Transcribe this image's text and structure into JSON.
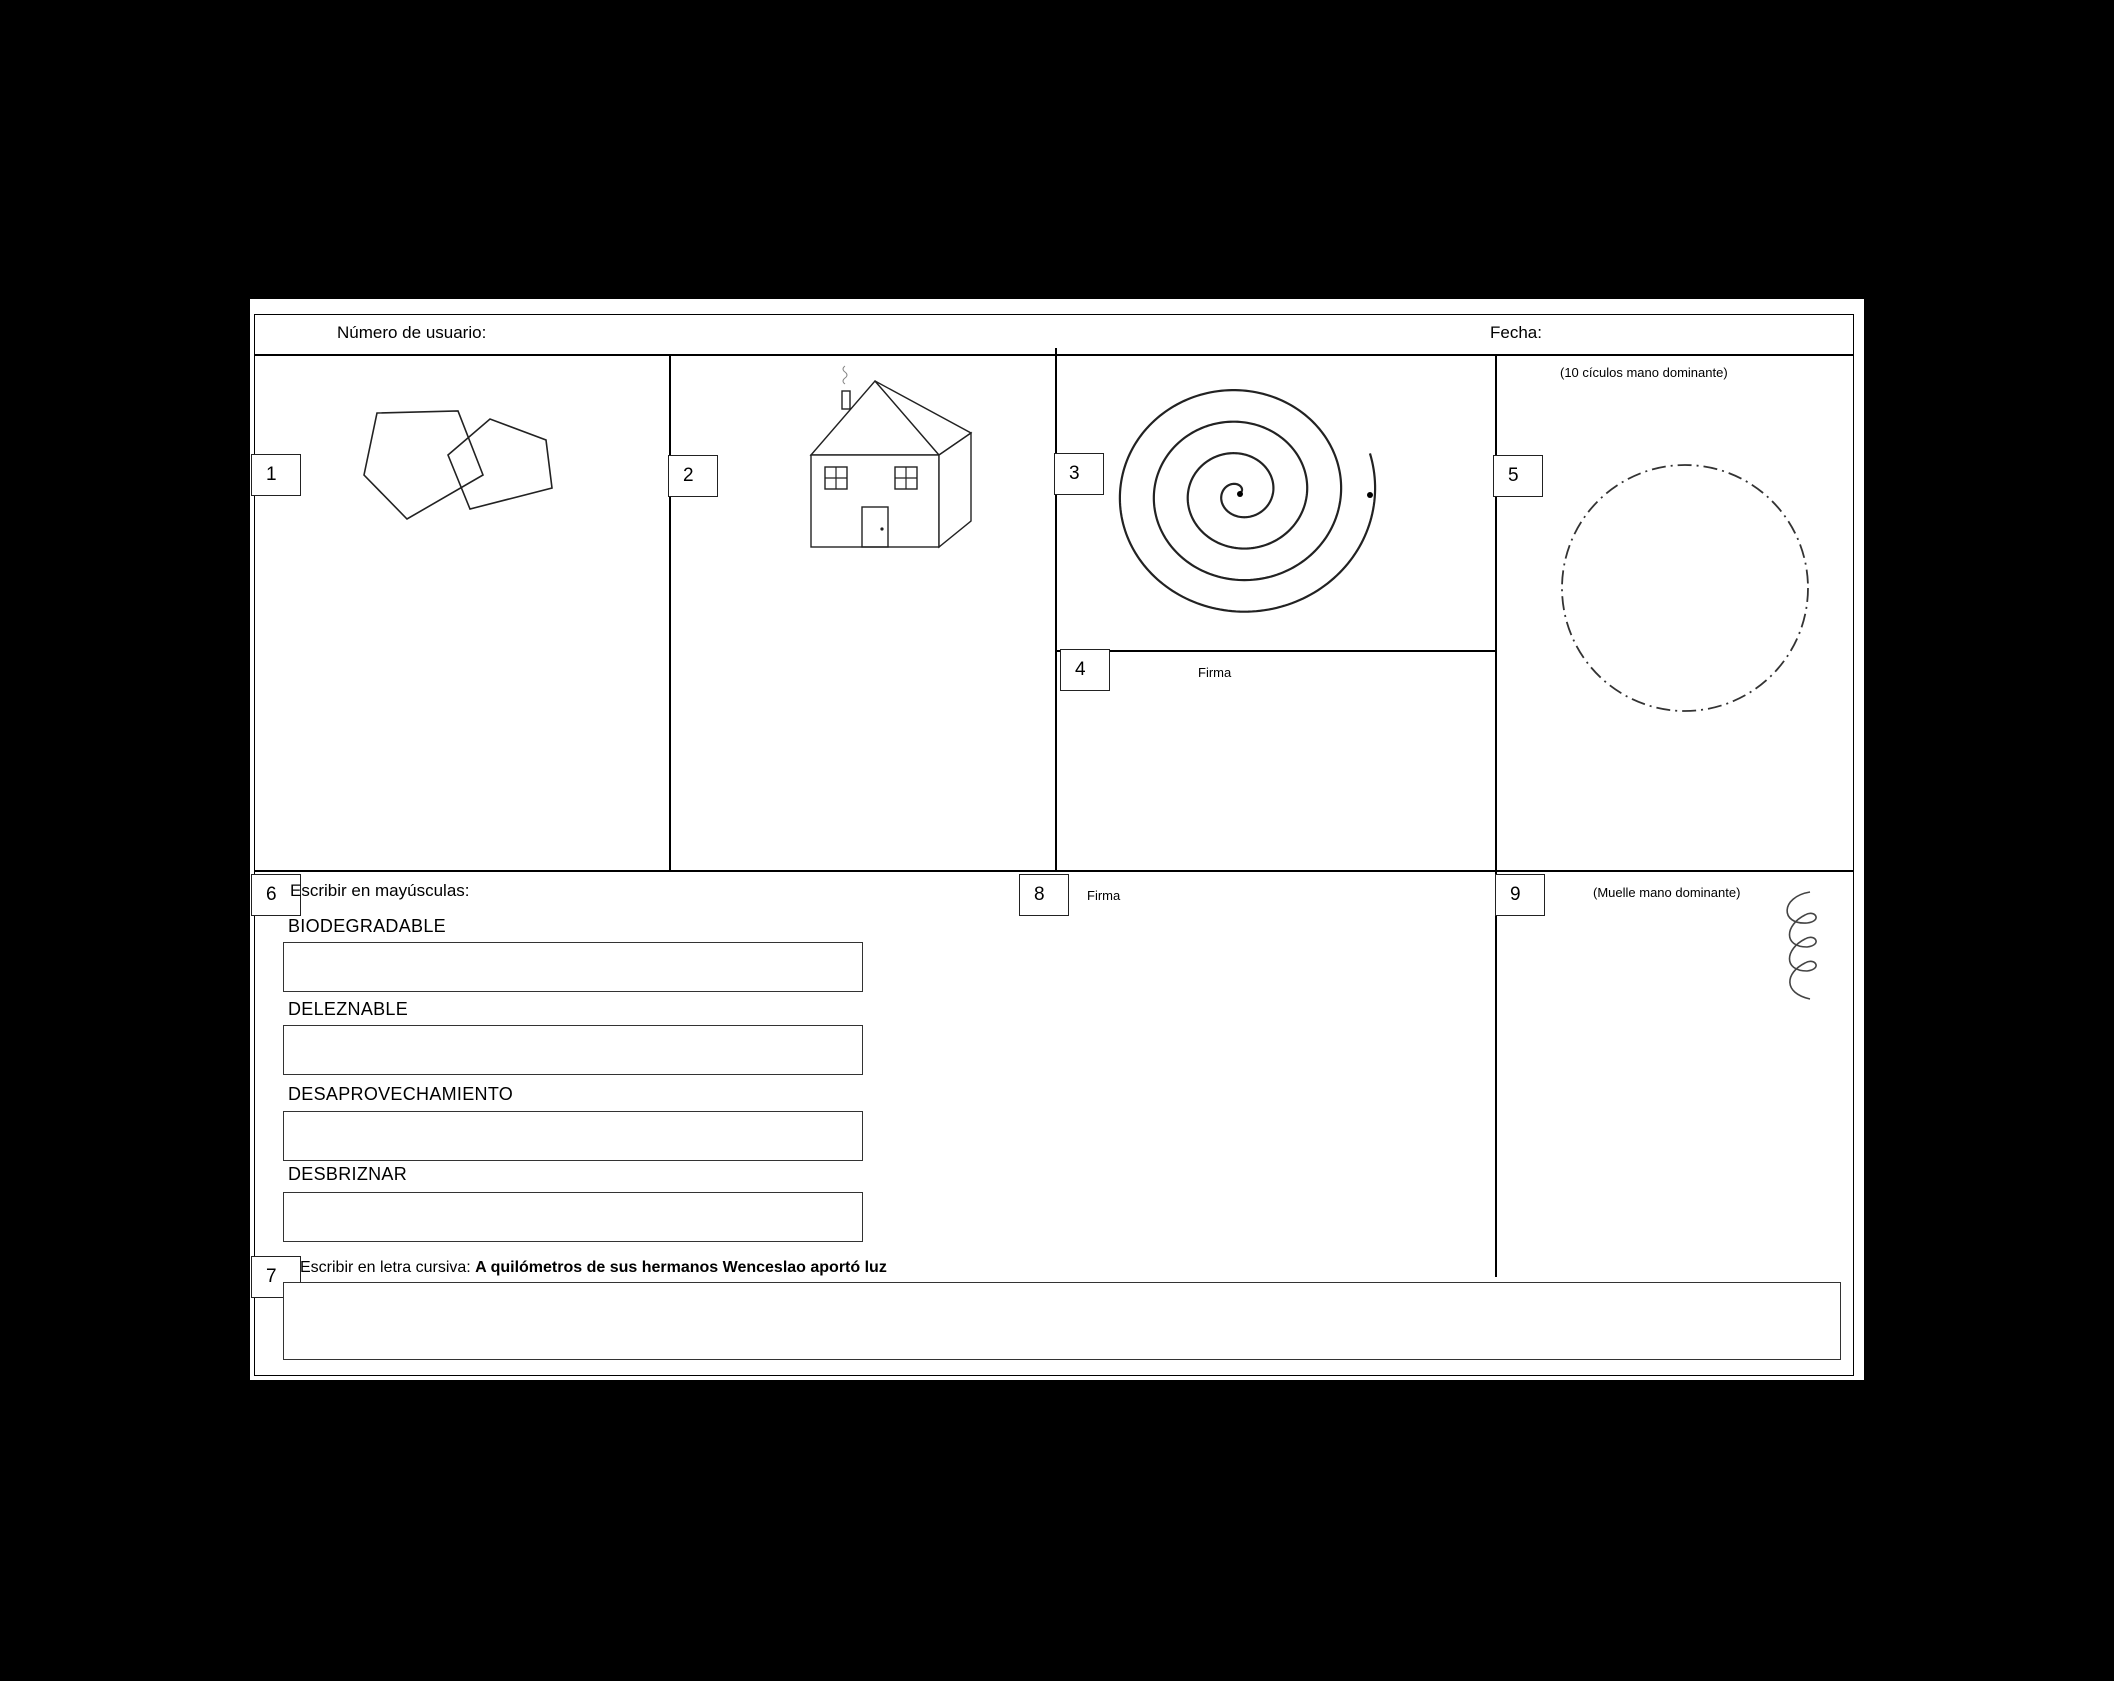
{
  "header": {
    "user_number_label": "Número de usuario:",
    "date_label": "Fecha:"
  },
  "tasks": {
    "t1": {
      "number": "1"
    },
    "t2": {
      "number": "2"
    },
    "t3": {
      "number": "3"
    },
    "t4": {
      "number": "4",
      "label": "Firma"
    },
    "t5": {
      "number": "5",
      "instruction": "(10 cículos mano dominante)"
    },
    "t6": {
      "number": "6",
      "instruction": "Escribir en mayúsculas:",
      "words": [
        "BIODEGRADABLE",
        "DELEZNABLE",
        "DESAPROVECHAMIENTO",
        "DESBRIZNAR"
      ]
    },
    "t7": {
      "number": "7",
      "instruction": "Escribir en letra cursiva:",
      "sentence": "A quilómetros de sus hermanos Wenceslao aportó luz"
    },
    "t8": {
      "number": "8",
      "label": "Firma"
    },
    "t9": {
      "number": "9",
      "instruction": "(Muelle mano dominante)"
    }
  },
  "icons": [
    "overlapping-pentagons-icon",
    "house-icon",
    "spiral-icon",
    "dashed-circle-icon",
    "spring-coil-icon"
  ]
}
